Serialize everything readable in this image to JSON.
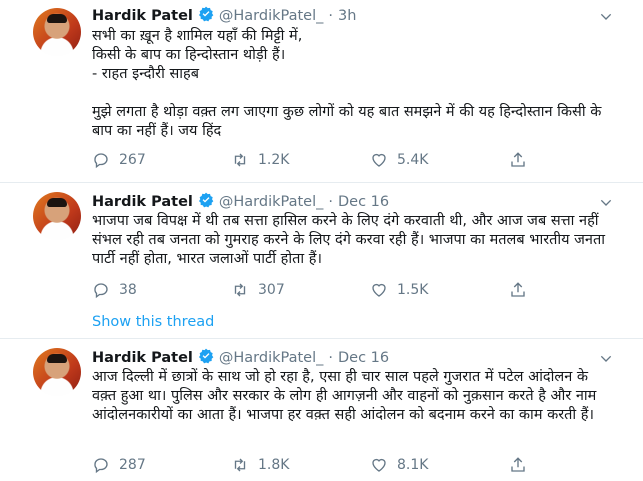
{
  "tweets": [
    {
      "name": "Hardik Patel",
      "handle": "@HardikPatel_",
      "separator": "·",
      "time": "3h",
      "text": "सभी का ख़ून है शामिल यहाँ की मिट्टी में,\nकिसी के बाप का हिन्दोस्तान थोड़ी हैं।\n- राहत इन्दौरी साहब\n\nमुझे लगता है थोड़ा वक़्त लग जाएगा कुछ लोगों को यह बात समझने में की यह हिन्दोस्तान किसी के बाप का नहीं हैं। जय हिंद",
      "replies": "267",
      "retweets": "1.2K",
      "likes": "5.4K"
    },
    {
      "name": "Hardik Patel",
      "handle": "@HardikPatel_",
      "separator": "·",
      "time": "Dec 16",
      "text": "भाजपा जब विपक्ष में थी तब सत्ता हासिल करने के लिए दंगे करवाती थी, और आज जब सत्ता नहीं संभल रही तब जनता को गुमराह करने के लिए दंगे करवा रही हैं। भाजपा का मतलब भारतीय जनता पार्टी नहीं होता, भारत जलाओं पार्टी होता हैं।",
      "replies": "38",
      "retweets": "307",
      "likes": "1.5K",
      "show_thread": "Show this thread"
    },
    {
      "name": "Hardik Patel",
      "handle": "@HardikPatel_",
      "separator": "·",
      "time": "Dec 16",
      "text": "आज दिल्ली में छात्रों के साथ जो हो रहा है, एसा ही चार साल पहले गुजरात में पटेल आंदोलन के वक़्त हुआ था। पुलिस और सरकार के लोग ही आगज़नी और वाहनों को नुक़सान करते है और नाम आंदोलनकारीयों का आता हैं। भाजपा हर वक़्त सही आंदोलन को बदनाम करने का काम करती हैं।",
      "replies": "287",
      "retweets": "1.8K",
      "likes": "8.1K"
    }
  ],
  "colors": {
    "accent": "#1da1f2",
    "muted": "#657786",
    "border": "#e6ecf0"
  },
  "icons": {
    "reply": "reply-icon",
    "retweet": "retweet-icon",
    "like": "heart-icon",
    "share": "share-icon",
    "more": "chevron-down-icon",
    "verified": "verified-badge-icon"
  }
}
